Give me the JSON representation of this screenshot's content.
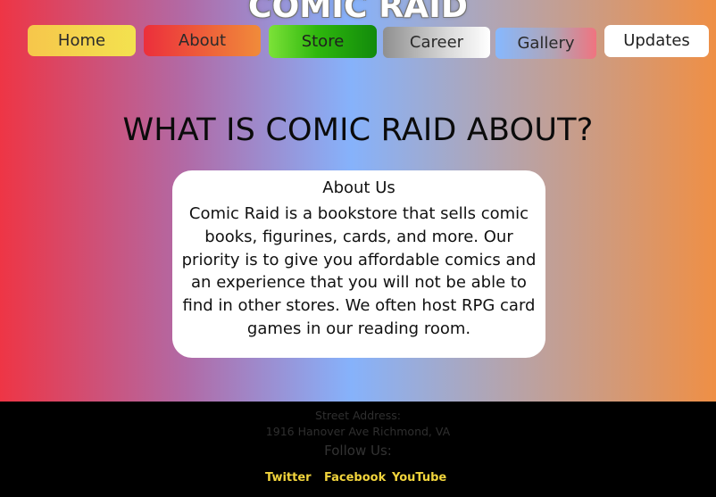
{
  "site": {
    "title": "COMIC RAID"
  },
  "nav": {
    "items": [
      {
        "label": "Home"
      },
      {
        "label": "About"
      },
      {
        "label": "Store"
      },
      {
        "label": "Career"
      },
      {
        "label": "Gallery"
      },
      {
        "label": "Updates"
      }
    ]
  },
  "main": {
    "heading": "WHAT IS COMIC RAID ABOUT?",
    "card": {
      "title": "About Us",
      "text": "Comic Raid is a bookstore that sells comic books, figurines, cards, and more. Our priority is to give you affordable comics and an experience that you will not be able to find in other stores. We often host RPG card games in our reading room."
    }
  },
  "footer": {
    "street_label": "Street Address:",
    "address": "1916 Hanover Ave Richmond, VA",
    "follow_label": "Follow Us:",
    "social": [
      {
        "label": "Twitter"
      },
      {
        "label": "Facebook"
      },
      {
        "label": "YouTube"
      }
    ]
  },
  "colors": {
    "accent_text": "#f1d43c",
    "card_bg": "#ffffff",
    "footer_bg": "#000000"
  }
}
